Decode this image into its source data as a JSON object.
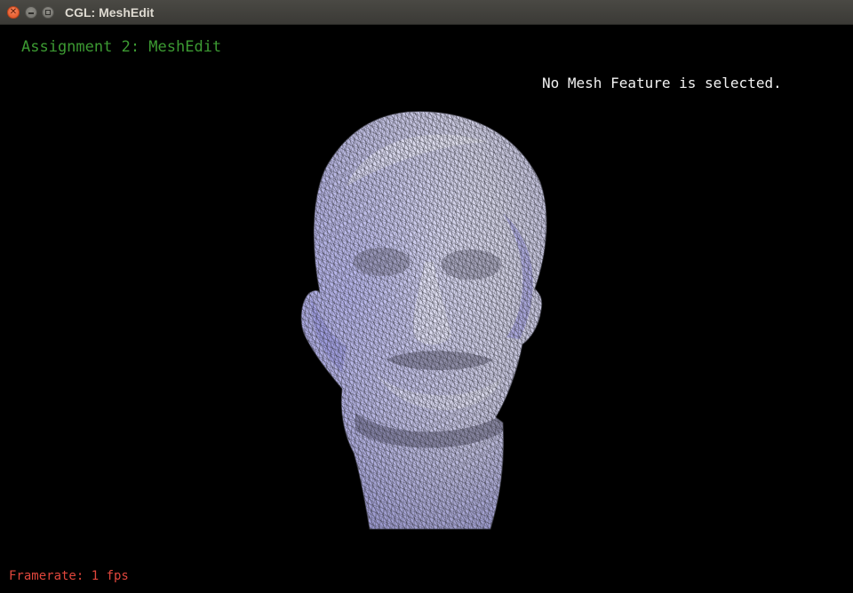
{
  "window": {
    "title": "CGL: MeshEdit",
    "controls": {
      "close_icon": "close-icon",
      "minimize_icon": "minimize-icon",
      "maximize_icon": "maximize-icon"
    }
  },
  "hud": {
    "assignment_title": "Assignment 2: MeshEdit",
    "selection_status": "No Mesh Feature is selected.",
    "framerate": "Framerate: 1 fps"
  },
  "colors": {
    "background": "#000000",
    "assignment_text": "#3c9a32",
    "selection_text": "#f2f2f2",
    "framerate_text": "#e0463c",
    "mesh_base": "#c9c9dc",
    "mesh_highlight": "#9a98f0",
    "mesh_wire": "#2a2a30"
  },
  "scene": {
    "object": "head-mesh"
  }
}
